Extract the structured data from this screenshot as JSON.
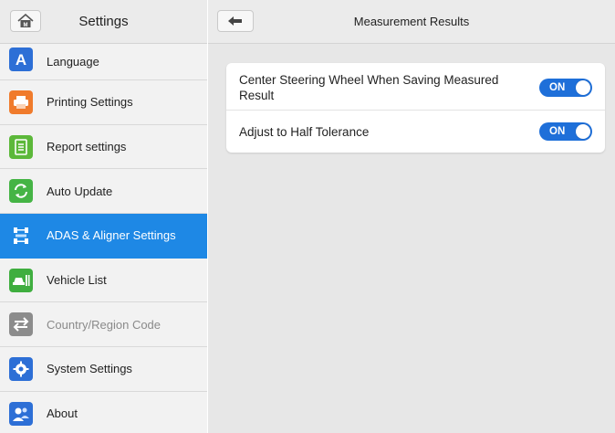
{
  "sidebar": {
    "title": "Settings",
    "items": [
      {
        "label": "Language",
        "icon": "language-icon",
        "color": "#2d6fd6"
      },
      {
        "label": "Printing Settings",
        "icon": "printer-icon",
        "color": "#f07b2c"
      },
      {
        "label": "Report settings",
        "icon": "report-icon",
        "color": "#5cb83a"
      },
      {
        "label": "Auto Update",
        "icon": "update-icon",
        "color": "#45b445"
      },
      {
        "label": "ADAS & Aligner Settings",
        "icon": "adas-icon",
        "color": "#ffffff"
      },
      {
        "label": "Vehicle List",
        "icon": "vehicle-list-icon",
        "color": "#3fae3f"
      },
      {
        "label": "Country/Region Code",
        "icon": "region-icon",
        "color": "#8c8c8c"
      },
      {
        "label": "System Settings",
        "icon": "system-settings-icon",
        "color": "#2d6fd6"
      },
      {
        "label": "About",
        "icon": "about-icon",
        "color": "#2d6fd6"
      }
    ],
    "active_index": 4
  },
  "main": {
    "title": "Measurement Results",
    "settings": [
      {
        "label": "Center Steering Wheel When Saving Measured Result",
        "state": "ON"
      },
      {
        "label": "Adjust to Half Tolerance",
        "state": "ON"
      }
    ]
  },
  "colors": {
    "accent": "#1e88e5",
    "toggle_on": "#1e6fd9"
  },
  "icons": {
    "home": "home-icon",
    "back": "back-arrow-icon"
  }
}
